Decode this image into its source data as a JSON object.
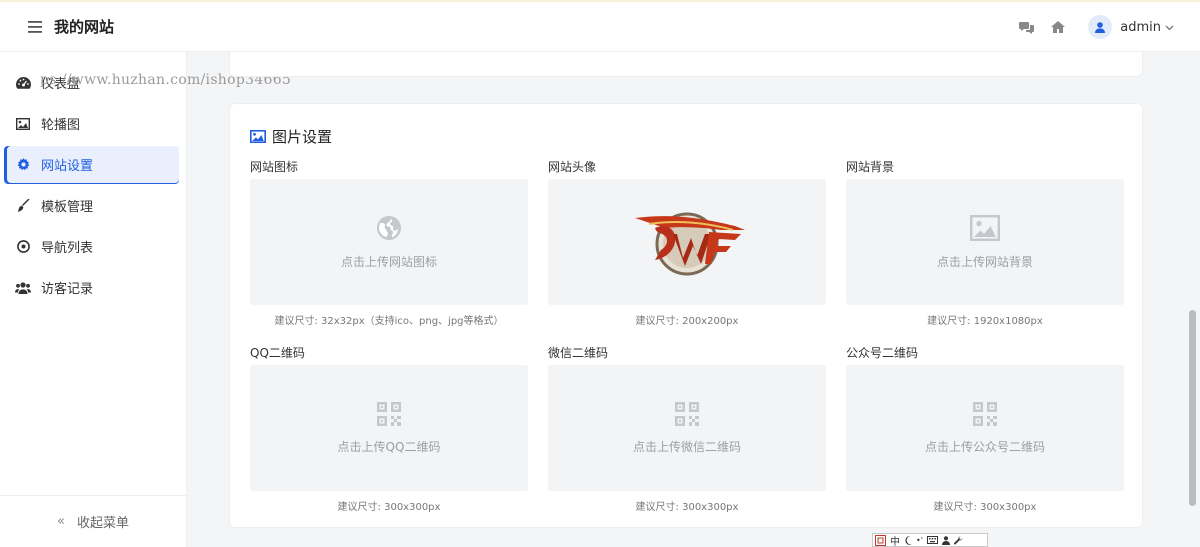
{
  "header": {
    "site_title": "我的网站",
    "user_name": "admin"
  },
  "sidebar": {
    "watermark": "ps://www.huzhan.com/ishop34665",
    "items": [
      {
        "label": "仪表盘",
        "icon": "dashboard-icon"
      },
      {
        "label": "轮播图",
        "icon": "image-icon"
      },
      {
        "label": "网站设置",
        "icon": "gear-icon",
        "active": true
      },
      {
        "label": "模板管理",
        "icon": "brush-icon"
      },
      {
        "label": "导航列表",
        "icon": "compass-icon"
      },
      {
        "label": "访客记录",
        "icon": "users-icon"
      }
    ],
    "collapse_arrow": "«",
    "collapse_label": "收起菜单"
  },
  "image_settings": {
    "title": "图片设置",
    "fields": [
      {
        "label": "网站图标",
        "placeholder": "点击上传网站图标",
        "hint": "建议尺寸: 32x32px（支持ico、png、jpg等格式）",
        "icon": "globe-icon"
      },
      {
        "label": "网站头像",
        "placeholder": "",
        "hint": "建议尺寸: 200x200px",
        "icon": "dnf-logo-image"
      },
      {
        "label": "网站背景",
        "placeholder": "点击上传网站背景",
        "hint": "建议尺寸: 1920x1080px",
        "icon": "picture-icon"
      },
      {
        "label": "QQ二维码",
        "placeholder": "点击上传QQ二维码",
        "hint": "建议尺寸: 300x300px",
        "icon": "qrcode-icon"
      },
      {
        "label": "微信二维码",
        "placeholder": "点击上传微信二维码",
        "hint": "建议尺寸: 300x300px",
        "icon": "qrcode-icon"
      },
      {
        "label": "公众号二维码",
        "placeholder": "点击上传公众号二维码",
        "hint": "建议尺寸: 300x300px",
        "icon": "qrcode-icon"
      }
    ]
  },
  "ime_bar": {
    "lang": "中",
    "punct": "•'"
  },
  "colors": {
    "accent": "#1f5fe0",
    "active_bg": "#e9effd",
    "upload_bg": "#f3f4f6"
  }
}
